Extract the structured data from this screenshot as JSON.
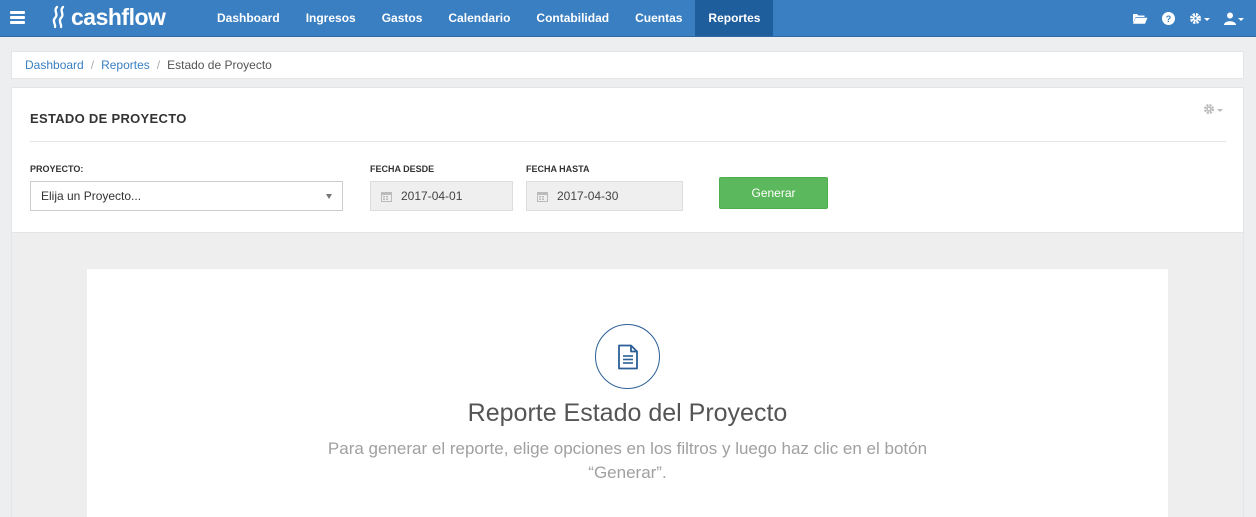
{
  "app": {
    "logo_text": "cashflow"
  },
  "nav": {
    "items": [
      {
        "label": "Dashboard",
        "active": false
      },
      {
        "label": "Ingresos",
        "active": false
      },
      {
        "label": "Gastos",
        "active": false
      },
      {
        "label": "Calendario",
        "active": false
      },
      {
        "label": "Contabilidad",
        "active": false
      },
      {
        "label": "Cuentas",
        "active": false
      },
      {
        "label": "Reportes",
        "active": true
      }
    ],
    "right_icons": [
      "folder-icon",
      "help-icon",
      "gear-icon",
      "user-icon"
    ]
  },
  "breadcrumb": {
    "items": [
      "Dashboard",
      "Reportes"
    ],
    "current": "Estado de Proyecto"
  },
  "panel": {
    "title": "ESTADO DE PROYECTO",
    "filters": {
      "project_label": "PROYECTO:",
      "project_value": "Elija un Proyecto...",
      "from_label": "FECHA DESDE",
      "from_value": "2017-04-01",
      "to_label": "FECHA HASTA",
      "to_value": "2017-04-30",
      "generate_label": "Generar"
    }
  },
  "report": {
    "icon": "document-icon",
    "title": "Reporte Estado del Proyecto",
    "description": "Para generar el reporte, elige opciones en los filtros y luego haz clic en el botón “Generar”."
  },
  "colors": {
    "nav_bg": "#3a7fc1",
    "nav_active": "#1f5e9c",
    "link": "#3a7fc1",
    "button_green": "#5cb85c",
    "icon_blue": "#2b5f96"
  }
}
